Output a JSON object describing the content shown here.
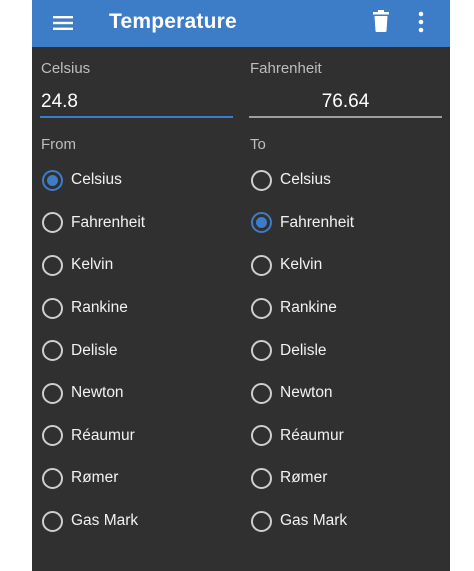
{
  "appbar": {
    "title": "Temperature",
    "icons": {
      "menu": "menu-icon",
      "delete": "trash-icon",
      "more": "more-vert-icon"
    },
    "color": "#3d7cc6"
  },
  "inputs": {
    "celsius_label": "Celsius",
    "celsius_value": "24.8",
    "fahrenheit_label": "Fahrenheit",
    "fahrenheit_value": "76.64"
  },
  "from": {
    "label": "From",
    "selected": "Celsius",
    "options": [
      "Celsius",
      "Fahrenheit",
      "Kelvin",
      "Rankine",
      "Delisle",
      "Newton",
      "Réaumur",
      "Rømer",
      "Gas Mark"
    ]
  },
  "to": {
    "label": "To",
    "selected": "Fahrenheit",
    "options": [
      "Celsius",
      "Fahrenheit",
      "Kelvin",
      "Rankine",
      "Delisle",
      "Newton",
      "Réaumur",
      "Rømer",
      "Gas Mark"
    ]
  },
  "colors": {
    "background": "#303030",
    "accent": "#3d7cc6",
    "text": "#f2f2f2",
    "muted": "#bdbdbd"
  }
}
